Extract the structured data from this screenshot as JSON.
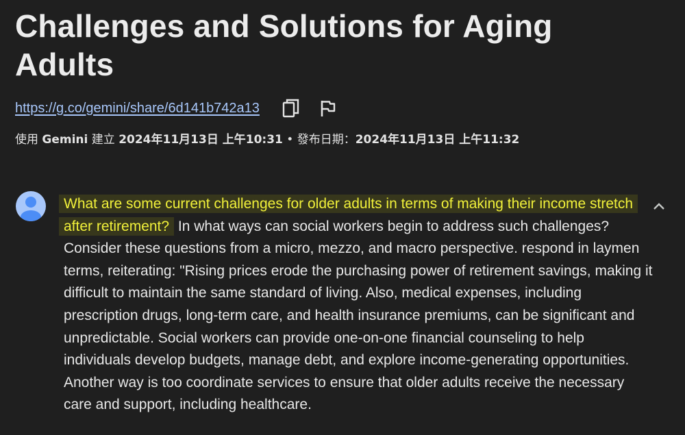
{
  "title": "Challenges and Solutions for Aging Adults",
  "share": {
    "url": "https://g.co/gemini/share/6d141b742a13",
    "copy_icon": "copy-icon",
    "flag_icon": "flag-icon"
  },
  "meta": {
    "created_prefix": "使用 ",
    "app_name": "Gemini",
    "created_label": " 建立 ",
    "created_date": "2024年11月13日 上午10:31",
    "separator": " • ",
    "published_label": "發布日期：",
    "published_date": "2024年11月13日 上午11:32"
  },
  "message": {
    "avatar_icon": "user-avatar-icon",
    "collapse_icon": "chevron-up-icon",
    "highlighted_text": "What are some current challenges for older adults in terms of making their income stretch after retirement?",
    "body_text": " In what ways can social workers begin to address such challenges? Consider these questions from a micro, mezzo, and macro perspective. respond in laymen terms, reiterating: \"Rising prices erode the purchasing power of retirement savings, making it difficult to maintain the same standard of living. Also, medical expenses, including prescription drugs, long-term care, and health insurance premiums, can be significant and unpredictable. Social workers can provide one-on-one financial counseling to help individuals develop budgets, manage debt, and explore income-generating opportunities. Another way is too coordinate services to ensure that older adults receive the necessary care and support, including healthcare.",
    "highlight_color": "#f1f13a",
    "highlight_bg": "#37371c"
  },
  "colors": {
    "background": "#1f1f1f",
    "link": "#a8c7fa",
    "text": "#e3e3e3",
    "avatar": "#a8c7fa"
  }
}
